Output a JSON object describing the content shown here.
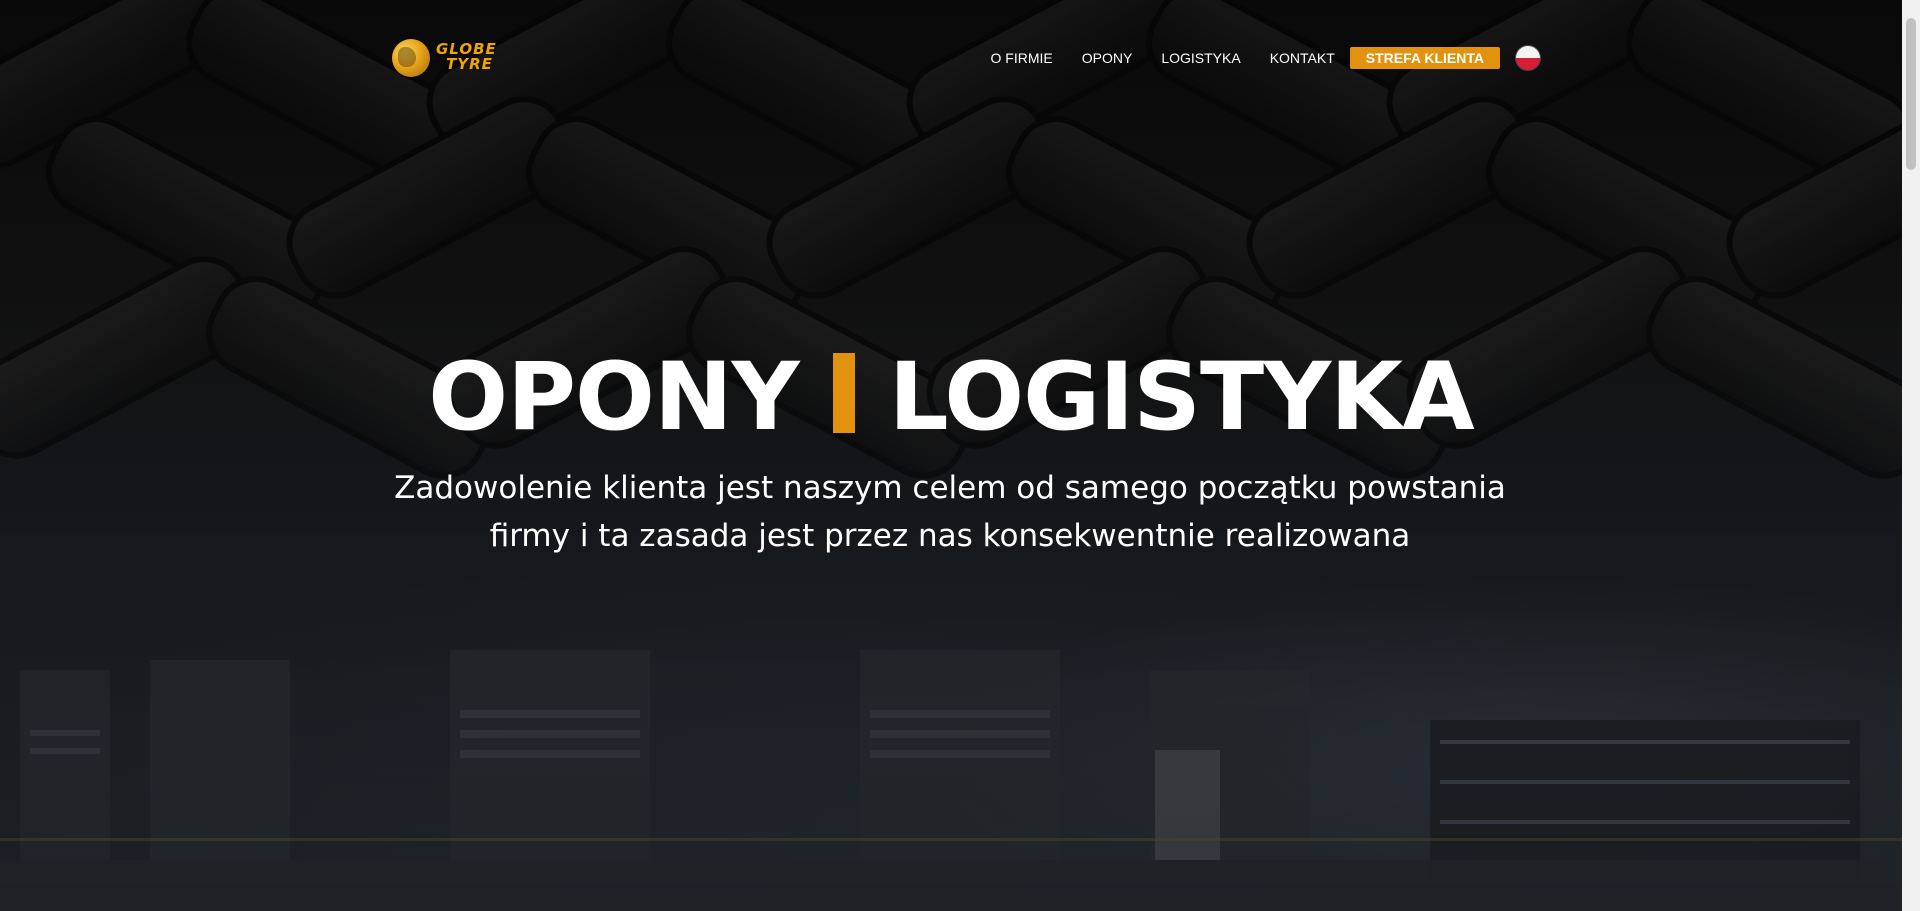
{
  "brand": {
    "name_line1": "GLOBE",
    "name_line2": "TYRE",
    "accent_color": "#e2920f"
  },
  "nav": {
    "items": [
      {
        "label": "O FIRMIE"
      },
      {
        "label": "OPONY"
      },
      {
        "label": "LOGISTYKA"
      },
      {
        "label": "KONTAKT"
      }
    ],
    "cta_label": "STREFA KLIENTA",
    "language_icon": "flag-pl-icon"
  },
  "hero": {
    "headline_left": "OPONY",
    "headline_right": "LOGISTYKA",
    "subtitle": "Zadowolenie klienta jest naszym celem od samego początku powstania firmy i ta zasada jest przez nas konsekwentnie realizowana"
  }
}
